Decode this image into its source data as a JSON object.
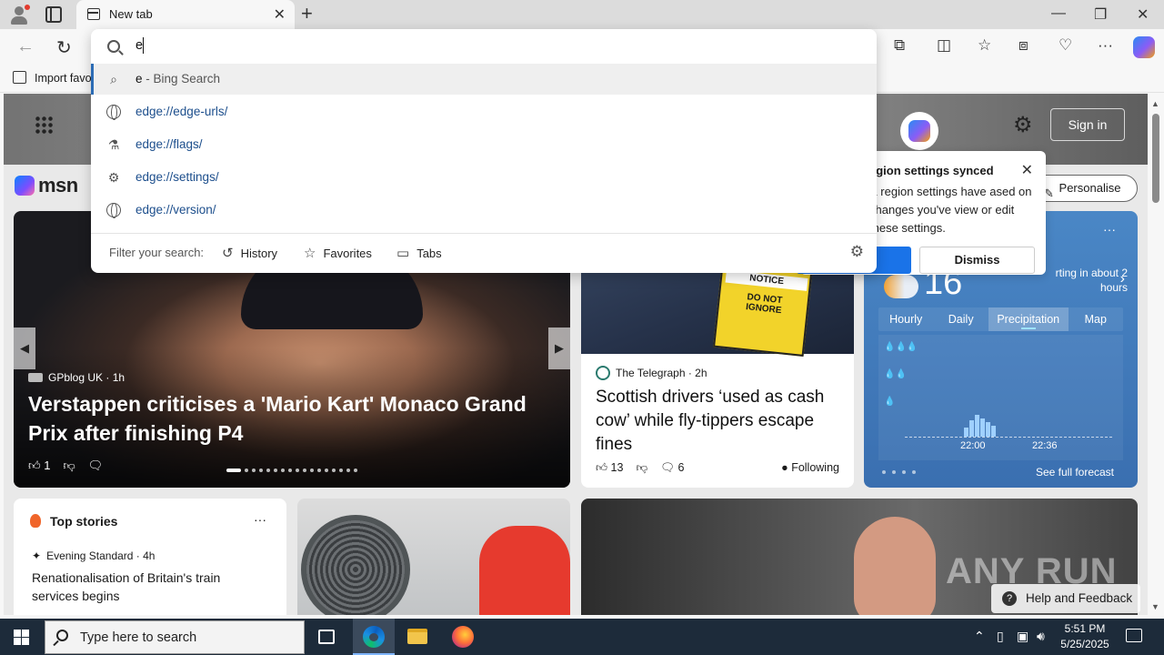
{
  "browser": {
    "tab_title": "New tab",
    "tab_close": "✕",
    "new_tab": "+",
    "minimize": "—",
    "maximize": "❐",
    "close": "✕"
  },
  "toolbar": {
    "back": "←",
    "refresh": "↻",
    "favorites_bar_item": "Import favo"
  },
  "omnibox": {
    "query": "e",
    "suggestions": [
      {
        "type": "search",
        "match": "e",
        "rest": " - Bing Search"
      },
      {
        "type": "url",
        "match": "e",
        "rest": "dge://edge-urls/"
      },
      {
        "type": "url",
        "match": "e",
        "rest": "dge://flags/"
      },
      {
        "type": "url",
        "match": "e",
        "rest": "dge://settings/"
      },
      {
        "type": "url",
        "match": "e",
        "rest": "dge://version/"
      }
    ],
    "filter_label": "Filter your search:",
    "filters": [
      "History",
      "Favorites",
      "Tabs"
    ]
  },
  "msn": {
    "logo": "msn",
    "sign_in": "Sign in",
    "personalise": "Personalise"
  },
  "notification": {
    "title": "egion settings synced",
    "body": "& region settings have ased on changes you've view or edit these settings.",
    "dismiss": "Dismiss"
  },
  "hero": {
    "source": "GPblog UK · 1h",
    "headline": "Verstappen criticises a 'Mario Kart' Monaco Grand Prix after finishing P4",
    "likes": "1",
    "prev": "◀",
    "next": "▶"
  },
  "telegraph": {
    "sign_line1": "NOTICE",
    "sign_line2": "DO NOT IGNORE",
    "source": "The Telegraph · 2h",
    "headline": "Scottish drivers ‘used as cash cow’ while fly-tippers escape fines",
    "likes": "13",
    "comments": "6",
    "following": "Following"
  },
  "weather": {
    "more": "···",
    "temp": "16",
    "starting": "rting in about 2 hours",
    "tabs": [
      "Hourly",
      "Daily",
      "Precipitation",
      "Map"
    ],
    "active_tab": "Precipitation",
    "time_labels": [
      "22:00",
      "22:36"
    ],
    "see_full": "See full forecast"
  },
  "top_stories": {
    "title": "Top stories",
    "more": "···",
    "source": "Evening Standard · 4h",
    "headline": "Renationalisation of Britain's train services begins"
  },
  "help": "Help and Feedback",
  "watermark": "ANY RUN",
  "taskbar": {
    "search_placeholder": "Type here to search",
    "time": "5:51 PM",
    "date": "5/25/2025"
  }
}
